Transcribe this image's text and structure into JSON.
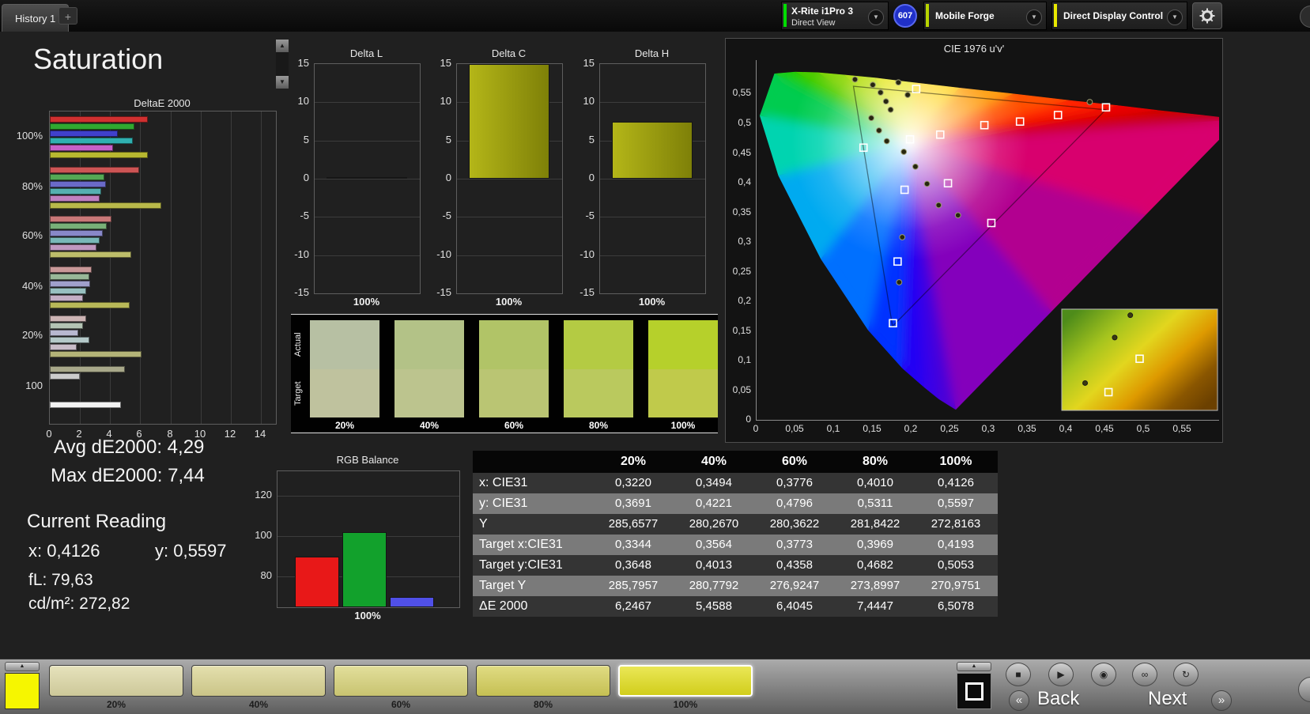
{
  "top_bar": {
    "history_tab": "History 1",
    "add_tab": "+",
    "meter": {
      "name": "X-Rite i1Pro 3",
      "mode": "Direct View",
      "indicator_color": "#00dd00"
    },
    "badge": "607",
    "source": {
      "name": "Mobile Forge",
      "indicator_color": "#b8d400"
    },
    "display_control": {
      "name": "Direct Display Control",
      "indicator_color": "#e8e800"
    }
  },
  "page": {
    "title": "Saturation"
  },
  "icons": {
    "chevron_down": "▼",
    "up_arrow": "▲",
    "down_arrow": "▼",
    "stop": "■",
    "play": "▶",
    "record": "◉",
    "loop": "∞",
    "refresh": "↻",
    "back_chevron": "«",
    "next_chevron": "»"
  },
  "stats": {
    "avg": "Avg dE2000: 4,29",
    "max": "Max dE2000: 7,44",
    "current": "Current Reading",
    "x": "x: 0,4126",
    "y": "y: 0,5597",
    "fl": "fL: 79,63",
    "cd": "cd/m²: 272,82"
  },
  "chart_data": {
    "deltaE2000": {
      "type": "bar",
      "orientation": "horizontal",
      "title": "DeltaE 2000",
      "xlim": [
        0,
        14
      ],
      "xticks": [
        0,
        2,
        4,
        6,
        8,
        10,
        12,
        14
      ],
      "groups": [
        {
          "label": "100%",
          "bars": [
            {
              "color": "#d03030",
              "value": 6.5
            },
            {
              "color": "#30a830",
              "value": 5.6
            },
            {
              "color": "#4040cc",
              "value": 4.5
            },
            {
              "color": "#30b0b0",
              "value": 5.5
            },
            {
              "color": "#c860c8",
              "value": 4.2
            },
            {
              "color": "#b8b830",
              "value": 6.5
            }
          ]
        },
        {
          "label": "80%",
          "bars": [
            {
              "color": "#cc5555",
              "value": 5.9
            },
            {
              "color": "#55a855",
              "value": 3.6
            },
            {
              "color": "#6a6ac8",
              "value": 3.7
            },
            {
              "color": "#55b0b0",
              "value": 3.4
            },
            {
              "color": "#c080c0",
              "value": 3.3
            },
            {
              "color": "#b8b84a",
              "value": 7.4
            }
          ]
        },
        {
          "label": "60%",
          "bars": [
            {
              "color": "#c87878",
              "value": 4.1
            },
            {
              "color": "#78b078",
              "value": 3.8
            },
            {
              "color": "#8888c8",
              "value": 3.5
            },
            {
              "color": "#78b8b8",
              "value": 3.3
            },
            {
              "color": "#c098c0",
              "value": 3.1
            },
            {
              "color": "#bcbc6a",
              "value": 5.4
            }
          ]
        },
        {
          "label": "40%",
          "bars": [
            {
              "color": "#c89898",
              "value": 2.8
            },
            {
              "color": "#98b898",
              "value": 2.6
            },
            {
              "color": "#a0a0cc",
              "value": 2.7
            },
            {
              "color": "#98c0c0",
              "value": 2.4
            },
            {
              "color": "#c4aec4",
              "value": 2.2
            },
            {
              "color": "#b8b858",
              "value": 5.3
            }
          ]
        },
        {
          "label": "20%",
          "bars": [
            {
              "color": "#ccb4b4",
              "value": 2.4
            },
            {
              "color": "#b4c4b4",
              "value": 2.2
            },
            {
              "color": "#b8b8d0",
              "value": 1.9
            },
            {
              "color": "#b4c8c8",
              "value": 2.6
            },
            {
              "color": "#c8bcc8",
              "value": 1.8
            },
            {
              "color": "#b4b478",
              "value": 6.1
            }
          ]
        },
        {
          "label": "100",
          "bars": [
            {
              "color": "#a8a88a",
              "value": 5.0
            },
            {
              "color": "#cccccc",
              "value": 2.0
            },
            null,
            null,
            null,
            {
              "color": "#f2f2f2",
              "value": 4.7
            }
          ]
        }
      ]
    },
    "deltaL": {
      "type": "bar",
      "title": "Delta L",
      "categories": [
        "100%"
      ],
      "values": [
        0.2
      ],
      "ylim": [
        -15,
        15
      ],
      "yticks": [
        15,
        10,
        5,
        0,
        -5,
        -10,
        -15
      ],
      "color": "#b4b618"
    },
    "deltaC": {
      "type": "bar",
      "title": "Delta C",
      "categories": [
        "100%"
      ],
      "values": [
        15.6
      ],
      "ylim": [
        -15,
        15
      ],
      "yticks": [
        15,
        10,
        5,
        0,
        -5,
        -10,
        -15
      ],
      "color": "#b4b618"
    },
    "deltaH": {
      "type": "bar",
      "title": "Delta H",
      "categories": [
        "100%"
      ],
      "values": [
        7.4
      ],
      "ylim": [
        -15,
        15
      ],
      "yticks": [
        15,
        10,
        5,
        0,
        -5,
        -10,
        -15
      ],
      "color": "#b4b618"
    },
    "rgb_balance": {
      "type": "bar",
      "title": "RGB Balance",
      "categories": [
        "Red",
        "Green",
        "Blue"
      ],
      "values": [
        90,
        102,
        70
      ],
      "colors": [
        "#e81818",
        "#12a12c",
        "#5050e8"
      ],
      "ylim": [
        65,
        132
      ],
      "yticks": [
        120,
        100,
        80
      ],
      "xlabel": "100%"
    },
    "cie": {
      "type": "scatter",
      "title": "CIE 1976 u'v'",
      "xtick_labels": [
        "0",
        "0,05",
        "0,1",
        "0,15",
        "0,2",
        "0,25",
        "0,3",
        "0,35",
        "0,4",
        "0,45",
        "0,5",
        "0,55"
      ],
      "ytick_labels": [
        "0",
        "0,05",
        "0,1",
        "0,15",
        "0,2",
        "0,25",
        "0,3",
        "0,35",
        "0,4",
        "0,45",
        "0,5",
        "0,55"
      ],
      "targets": [
        [
          0.206,
          0.558
        ],
        [
          0.198,
          0.473
        ],
        [
          0.138,
          0.459
        ],
        [
          0.237,
          0.481
        ],
        [
          0.294,
          0.497
        ],
        [
          0.34,
          0.503
        ],
        [
          0.389,
          0.514
        ],
        [
          0.451,
          0.527
        ],
        [
          0.191,
          0.388
        ],
        [
          0.247,
          0.399
        ],
        [
          0.303,
          0.332
        ],
        [
          0.182,
          0.267
        ],
        [
          0.176,
          0.163
        ]
      ],
      "measurements": [
        [
          0.127,
          0.574
        ],
        [
          0.15,
          0.565
        ],
        [
          0.16,
          0.552
        ],
        [
          0.183,
          0.569
        ],
        [
          0.195,
          0.548
        ],
        [
          0.167,
          0.537
        ],
        [
          0.173,
          0.523
        ],
        [
          0.148,
          0.509
        ],
        [
          0.158,
          0.488
        ],
        [
          0.168,
          0.47
        ],
        [
          0.19,
          0.452
        ],
        [
          0.205,
          0.427
        ],
        [
          0.22,
          0.398
        ],
        [
          0.235,
          0.362
        ],
        [
          0.188,
          0.308
        ],
        [
          0.26,
          0.345
        ],
        [
          0.184,
          0.232
        ],
        [
          0.43,
          0.536
        ]
      ],
      "inset": {
        "squares": [
          [
            0.5,
            0.49
          ],
          [
            0.3,
            0.82
          ]
        ],
        "circles": [
          [
            0.44,
            0.06
          ],
          [
            0.34,
            0.28
          ],
          [
            0.15,
            0.73
          ]
        ]
      }
    }
  },
  "comparison": {
    "row_labels": [
      "Actual",
      "Target"
    ],
    "columns": [
      {
        "label": "20%",
        "actual": "#b7c0a3",
        "target": "#bfc29e"
      },
      {
        "label": "40%",
        "actual": "#b3c287",
        "target": "#bcc48e"
      },
      {
        "label": "60%",
        "actual": "#b1c467",
        "target": "#bac573"
      },
      {
        "label": "80%",
        "actual": "#b4cb43",
        "target": "#bac95e"
      },
      {
        "label": "100%",
        "actual": "#b6d02b",
        "target": "#c0ca4b"
      }
    ]
  },
  "table": {
    "headers": [
      "",
      "20%",
      "40%",
      "60%",
      "80%",
      "100%"
    ],
    "rows": [
      {
        "label": "x: CIE31",
        "shade": "dark",
        "values": [
          "0,3220",
          "0,3494",
          "0,3776",
          "0,4010",
          "0,4126"
        ]
      },
      {
        "label": "y: CIE31",
        "shade": "light",
        "values": [
          "0,3691",
          "0,4221",
          "0,4796",
          "0,5311",
          "0,5597"
        ]
      },
      {
        "label": "Y",
        "shade": "dark",
        "values": [
          "285,6577",
          "280,2670",
          "280,3622",
          "281,8422",
          "272,8163"
        ]
      },
      {
        "label": "Target x:CIE31",
        "shade": "light",
        "values": [
          "0,3344",
          "0,3564",
          "0,3773",
          "0,3969",
          "0,4193"
        ]
      },
      {
        "label": "Target y:CIE31",
        "shade": "dark",
        "values": [
          "0,3648",
          "0,4013",
          "0,4358",
          "0,4682",
          "0,5053"
        ]
      },
      {
        "label": "Target Y",
        "shade": "light",
        "values": [
          "285,7957",
          "280,7792",
          "276,9247",
          "273,8997",
          "270,9751"
        ]
      },
      {
        "label": "ΔE 2000",
        "shade": "dark",
        "values": [
          "6,2467",
          "5,4588",
          "6,4045",
          "7,4447",
          "6,5078"
        ]
      }
    ]
  },
  "bottom_bar": {
    "current_color": "#f6f600",
    "swatches": [
      {
        "label": "20%",
        "color": "#ded9a6",
        "selected": false
      },
      {
        "label": "40%",
        "color": "#dbd593",
        "selected": false
      },
      {
        "label": "60%",
        "color": "#d9d47a",
        "selected": false
      },
      {
        "label": "80%",
        "color": "#d6d05a",
        "selected": false
      },
      {
        "label": "100%",
        "color": "#e3df1e",
        "selected": true
      }
    ],
    "back": "Back",
    "next": "Next"
  }
}
